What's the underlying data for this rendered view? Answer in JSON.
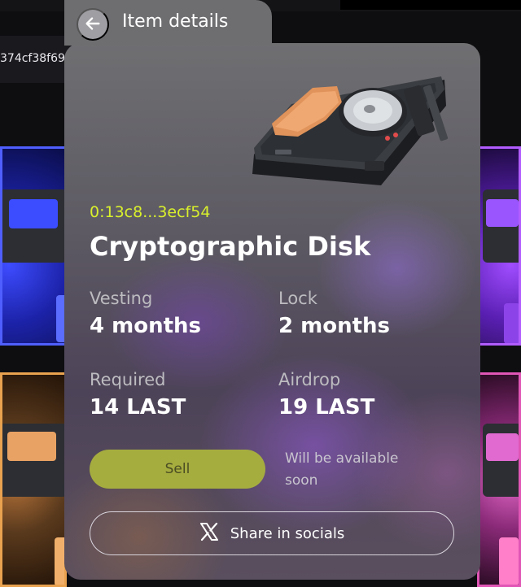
{
  "background": {
    "wallet_address_fragment": "374cf38f69",
    "colors": {
      "card_blue": "#4f5fff",
      "card_purple": "#b25cff",
      "card_orange": "#e9a24f",
      "card_pink": "#e056b5"
    }
  },
  "modal": {
    "title": "Item details",
    "back_icon": "arrow-left-icon",
    "item": {
      "id": "0:13c8...3ecf54",
      "name": "Cryptographic Disk",
      "image": "cryptographic-disk-illustration"
    },
    "stats": [
      {
        "label": "Vesting",
        "value": "4 months"
      },
      {
        "label": "Lock",
        "value": "2 months"
      },
      {
        "label": "Required",
        "value": "14 LAST"
      },
      {
        "label": "Airdrop",
        "value": "19 LAST"
      }
    ],
    "sell_label": "Sell",
    "sell_note": "Will be available soon",
    "share": {
      "icon": "x-logo-icon",
      "label": "Share in socials"
    },
    "colors": {
      "accent": "#d9f02c",
      "sell_button": "#a6ad3f"
    }
  }
}
